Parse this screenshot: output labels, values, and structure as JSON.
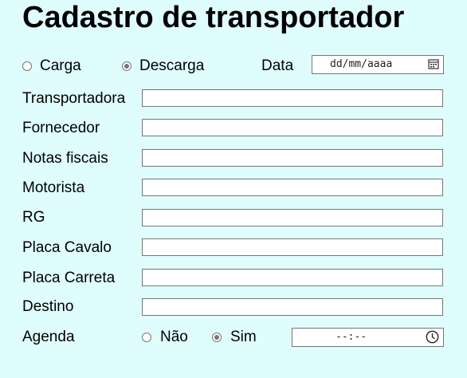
{
  "page": {
    "title": "Cadastro de transportador"
  },
  "operation": {
    "options": [
      {
        "label": "Carga",
        "checked": false
      },
      {
        "label": "Descarga",
        "checked": true
      }
    ],
    "date_label": "Data",
    "date_placeholder": "dd/mm/aaaa"
  },
  "fields": [
    {
      "label": "Transportadora",
      "value": ""
    },
    {
      "label": "Fornecedor",
      "value": ""
    },
    {
      "label": "Notas fiscais",
      "value": ""
    },
    {
      "label": "Motorista",
      "value": ""
    },
    {
      "label": "RG",
      "value": ""
    },
    {
      "label": "Placa Cavalo",
      "value": ""
    },
    {
      "label": "Placa Carreta",
      "value": ""
    },
    {
      "label": "Destino",
      "value": ""
    }
  ],
  "agenda": {
    "label": "Agenda",
    "options": [
      {
        "label": "Não",
        "checked": false
      },
      {
        "label": "Sim",
        "checked": true
      }
    ],
    "time_placeholder": "--:--"
  },
  "icons": {
    "date": "calendar-icon",
    "time": "clock-icon"
  }
}
